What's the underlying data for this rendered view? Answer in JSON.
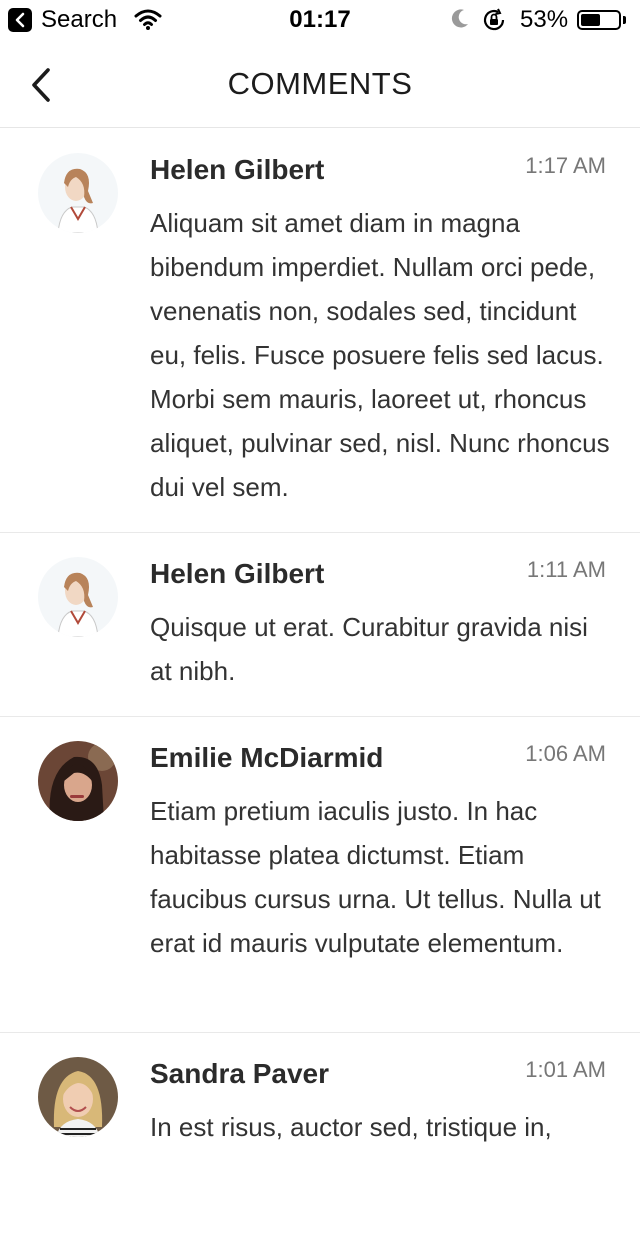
{
  "status_bar": {
    "back_app_label": "Search",
    "time": "01:17",
    "battery_percent": "53%",
    "battery_level": 0.53
  },
  "nav": {
    "title": "COMMENTS"
  },
  "comments": [
    {
      "author": "Helen Gilbert",
      "time": "1:17 AM",
      "text": "Aliquam sit amet diam in magna bibendum imperdiet. Nullam orci pede, venenatis non, sodales sed, tincidunt eu, felis. Fusce posuere felis sed lacus. Morbi sem mauris, laoreet ut, rhoncus aliquet, pulvinar sed, nisl. Nunc rhoncus dui vel sem."
    },
    {
      "author": "Helen Gilbert",
      "time": "1:11 AM",
      "text": "Quisque ut erat. Curabitur gravida nisi at nibh."
    },
    {
      "author": "Emilie McDiarmid",
      "time": "1:06 AM",
      "text": "Etiam pretium iaculis justo. In hac habitasse platea dictumst. Etiam faucibus cursus urna. Ut tellus. Nulla ut erat id mauris vulputate elementum."
    },
    {
      "author": "Sandra Paver",
      "time": "1:01 AM",
      "text": "In est risus, auctor sed, tristique in,"
    }
  ]
}
